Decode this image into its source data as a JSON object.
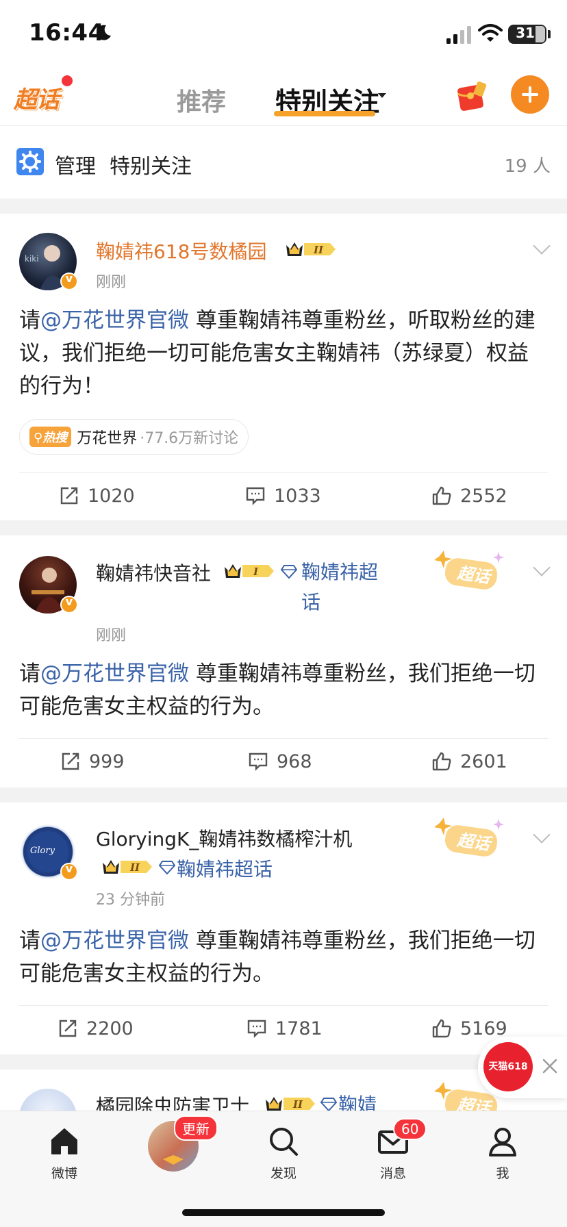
{
  "status_bar": {
    "time": "16:44",
    "battery": "31"
  },
  "top_nav": {
    "logo": "超话",
    "tabs": [
      {
        "label": "推荐"
      },
      {
        "label": "特别关注"
      }
    ]
  },
  "manage_row": {
    "manage": "管理",
    "title": "特别关注",
    "count": "19 人"
  },
  "posts": [
    {
      "username": "鞠婧祎618号数橘园",
      "level": "II",
      "time": "刚刚",
      "text_prefix": "请",
      "mention": "@万花世界官微",
      "text_body": " 尊重鞠婧祎尊重粉丝，听取粉丝的建议，我们拒绝一切可能危害女主鞠婧祎（苏绿夏）权益的行为！",
      "hot_tag": "热搜",
      "hot_topic": "万花世界",
      "hot_count": "·77.6万新讨论",
      "reposts": "1020",
      "comments": "1033",
      "likes": "2552"
    },
    {
      "username": "鞠婧祎快音社",
      "level": "I",
      "tag": "鞠婧祎超话",
      "sticker": "超话",
      "time": "刚刚",
      "text_prefix": "请",
      "mention": "@万花世界官微",
      "text_body": " 尊重鞠婧祎尊重粉丝，我们拒绝一切可能危害女主权益的行为。",
      "reposts": "999",
      "comments": "968",
      "likes": "2601"
    },
    {
      "username": "GloryingK_鞠婧祎数橘榨汁机",
      "level": "II",
      "tag": "鞠婧祎超话",
      "sticker": "超话",
      "time": "23 分钟前",
      "text_prefix": "请",
      "mention": "@万花世界官微",
      "text_body": " 尊重鞠婧祎尊重粉丝，我们拒绝一切可能危害女主权益的行为。",
      "reposts": "2200",
      "comments": "1781",
      "likes": "5169"
    },
    {
      "username": "橘园除虫防害卫士",
      "level": "II",
      "tag": "鞠婧",
      "sticker": "超话"
    }
  ],
  "floating_ad": {
    "label": "天猫618"
  },
  "tab_bar": {
    "items": [
      {
        "label": "微博"
      },
      {
        "label": "更新"
      },
      {
        "label": "发现"
      },
      {
        "label": "消息",
        "badge": "60"
      },
      {
        "label": "我"
      }
    ]
  },
  "colors": {
    "accent": "#f58a23",
    "link": "#3a63a8",
    "username": "#e2762c"
  }
}
